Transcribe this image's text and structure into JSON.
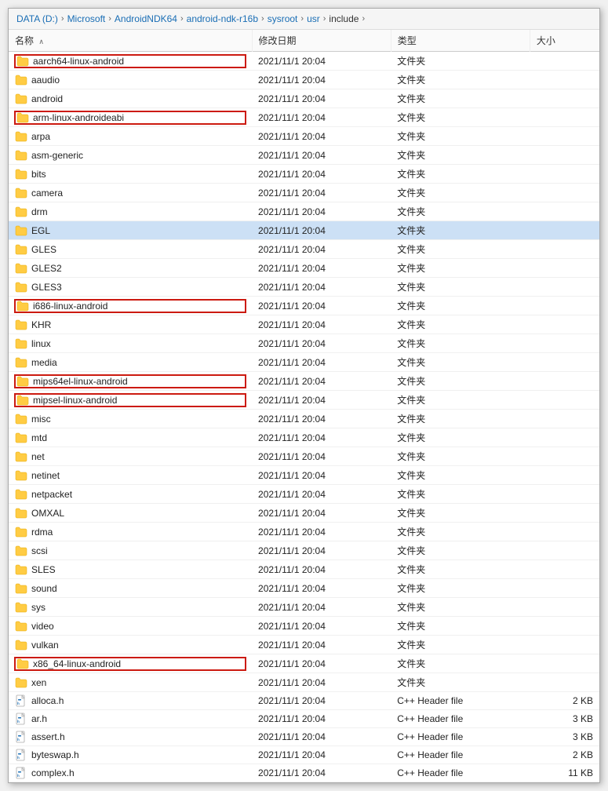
{
  "breadcrumb": {
    "items": [
      {
        "label": "DATA (D:)"
      },
      {
        "label": "Microsoft"
      },
      {
        "label": "AndroidNDK64"
      },
      {
        "label": "android-ndk-r16b"
      },
      {
        "label": "sysroot"
      },
      {
        "label": "usr"
      },
      {
        "label": "include"
      }
    ]
  },
  "columns": {
    "name": "名称",
    "date": "修改日期",
    "type": "类型",
    "size": "大小"
  },
  "files": [
    {
      "name": "aarch64-linux-android",
      "date": "2021/11/1 20:04",
      "type": "文件夹",
      "size": "",
      "isFolder": true,
      "redBorder": true,
      "selected": false
    },
    {
      "name": "aaudio",
      "date": "2021/11/1 20:04",
      "type": "文件夹",
      "size": "",
      "isFolder": true,
      "redBorder": false,
      "selected": false
    },
    {
      "name": "android",
      "date": "2021/11/1 20:04",
      "type": "文件夹",
      "size": "",
      "isFolder": true,
      "redBorder": false,
      "selected": false
    },
    {
      "name": "arm-linux-androideabi",
      "date": "2021/11/1 20:04",
      "type": "文件夹",
      "size": "",
      "isFolder": true,
      "redBorder": true,
      "selected": false
    },
    {
      "name": "arpa",
      "date": "2021/11/1 20:04",
      "type": "文件夹",
      "size": "",
      "isFolder": true,
      "redBorder": false,
      "selected": false
    },
    {
      "name": "asm-generic",
      "date": "2021/11/1 20:04",
      "type": "文件夹",
      "size": "",
      "isFolder": true,
      "redBorder": false,
      "selected": false
    },
    {
      "name": "bits",
      "date": "2021/11/1 20:04",
      "type": "文件夹",
      "size": "",
      "isFolder": true,
      "redBorder": false,
      "selected": false
    },
    {
      "name": "camera",
      "date": "2021/11/1 20:04",
      "type": "文件夹",
      "size": "",
      "isFolder": true,
      "redBorder": false,
      "selected": false
    },
    {
      "name": "drm",
      "date": "2021/11/1 20:04",
      "type": "文件夹",
      "size": "",
      "isFolder": true,
      "redBorder": false,
      "selected": false
    },
    {
      "name": "EGL",
      "date": "2021/11/1 20:04",
      "type": "文件夹",
      "size": "",
      "isFolder": true,
      "redBorder": false,
      "selected": true
    },
    {
      "name": "GLES",
      "date": "2021/11/1 20:04",
      "type": "文件夹",
      "size": "",
      "isFolder": true,
      "redBorder": false,
      "selected": false
    },
    {
      "name": "GLES2",
      "date": "2021/11/1 20:04",
      "type": "文件夹",
      "size": "",
      "isFolder": true,
      "redBorder": false,
      "selected": false
    },
    {
      "name": "GLES3",
      "date": "2021/11/1 20:04",
      "type": "文件夹",
      "size": "",
      "isFolder": true,
      "redBorder": false,
      "selected": false
    },
    {
      "name": "i686-linux-android",
      "date": "2021/11/1 20:04",
      "type": "文件夹",
      "size": "",
      "isFolder": true,
      "redBorder": true,
      "selected": false
    },
    {
      "name": "KHR",
      "date": "2021/11/1 20:04",
      "type": "文件夹",
      "size": "",
      "isFolder": true,
      "redBorder": false,
      "selected": false
    },
    {
      "name": "linux",
      "date": "2021/11/1 20:04",
      "type": "文件夹",
      "size": "",
      "isFolder": true,
      "redBorder": false,
      "selected": false
    },
    {
      "name": "media",
      "date": "2021/11/1 20:04",
      "type": "文件夹",
      "size": "",
      "isFolder": true,
      "redBorder": false,
      "selected": false
    },
    {
      "name": "mips64el-linux-android",
      "date": "2021/11/1 20:04",
      "type": "文件夹",
      "size": "",
      "isFolder": true,
      "redBorder": true,
      "selected": false
    },
    {
      "name": "mipsel-linux-android",
      "date": "2021/11/1 20:04",
      "type": "文件夹",
      "size": "",
      "isFolder": true,
      "redBorder": true,
      "selected": false
    },
    {
      "name": "misc",
      "date": "2021/11/1 20:04",
      "type": "文件夹",
      "size": "",
      "isFolder": true,
      "redBorder": false,
      "selected": false
    },
    {
      "name": "mtd",
      "date": "2021/11/1 20:04",
      "type": "文件夹",
      "size": "",
      "isFolder": true,
      "redBorder": false,
      "selected": false
    },
    {
      "name": "net",
      "date": "2021/11/1 20:04",
      "type": "文件夹",
      "size": "",
      "isFolder": true,
      "redBorder": false,
      "selected": false
    },
    {
      "name": "netinet",
      "date": "2021/11/1 20:04",
      "type": "文件夹",
      "size": "",
      "isFolder": true,
      "redBorder": false,
      "selected": false
    },
    {
      "name": "netpacket",
      "date": "2021/11/1 20:04",
      "type": "文件夹",
      "size": "",
      "isFolder": true,
      "redBorder": false,
      "selected": false
    },
    {
      "name": "OMXAL",
      "date": "2021/11/1 20:04",
      "type": "文件夹",
      "size": "",
      "isFolder": true,
      "redBorder": false,
      "selected": false
    },
    {
      "name": "rdma",
      "date": "2021/11/1 20:04",
      "type": "文件夹",
      "size": "",
      "isFolder": true,
      "redBorder": false,
      "selected": false
    },
    {
      "name": "scsi",
      "date": "2021/11/1 20:04",
      "type": "文件夹",
      "size": "",
      "isFolder": true,
      "redBorder": false,
      "selected": false
    },
    {
      "name": "SLES",
      "date": "2021/11/1 20:04",
      "type": "文件夹",
      "size": "",
      "isFolder": true,
      "redBorder": false,
      "selected": false
    },
    {
      "name": "sound",
      "date": "2021/11/1 20:04",
      "type": "文件夹",
      "size": "",
      "isFolder": true,
      "redBorder": false,
      "selected": false
    },
    {
      "name": "sys",
      "date": "2021/11/1 20:04",
      "type": "文件夹",
      "size": "",
      "isFolder": true,
      "redBorder": false,
      "selected": false
    },
    {
      "name": "video",
      "date": "2021/11/1 20:04",
      "type": "文件夹",
      "size": "",
      "isFolder": true,
      "redBorder": false,
      "selected": false
    },
    {
      "name": "vulkan",
      "date": "2021/11/1 20:04",
      "type": "文件夹",
      "size": "",
      "isFolder": true,
      "redBorder": false,
      "selected": false
    },
    {
      "name": "x86_64-linux-android",
      "date": "2021/11/1 20:04",
      "type": "文件夹",
      "size": "",
      "isFolder": true,
      "redBorder": true,
      "selected": false
    },
    {
      "name": "xen",
      "date": "2021/11/1 20:04",
      "type": "文件夹",
      "size": "",
      "isFolder": true,
      "redBorder": false,
      "selected": false
    },
    {
      "name": "alloca.h",
      "date": "2021/11/1 20:04",
      "type": "C++ Header file",
      "size": "2 KB",
      "isFolder": false,
      "redBorder": false,
      "selected": false
    },
    {
      "name": "ar.h",
      "date": "2021/11/1 20:04",
      "type": "C++ Header file",
      "size": "3 KB",
      "isFolder": false,
      "redBorder": false,
      "selected": false
    },
    {
      "name": "assert.h",
      "date": "2021/11/1 20:04",
      "type": "C++ Header file",
      "size": "3 KB",
      "isFolder": false,
      "redBorder": false,
      "selected": false
    },
    {
      "name": "byteswap.h",
      "date": "2021/11/1 20:04",
      "type": "C++ Header file",
      "size": "2 KB",
      "isFolder": false,
      "redBorder": false,
      "selected": false
    },
    {
      "name": "complex.h",
      "date": "2021/11/1 20:04",
      "type": "C++ Header file",
      "size": "11 KB",
      "isFolder": false,
      "redBorder": false,
      "selected": false
    }
  ]
}
